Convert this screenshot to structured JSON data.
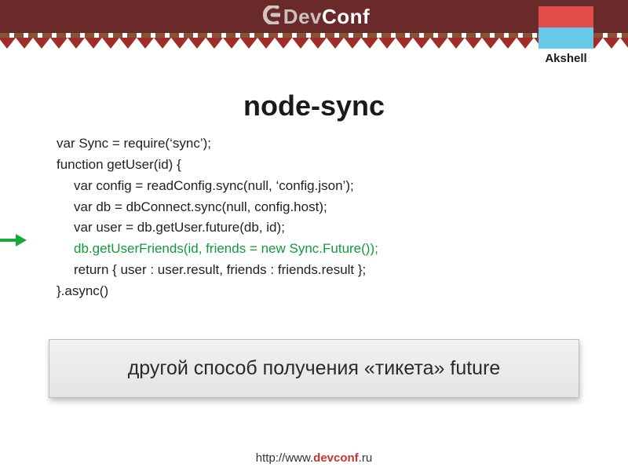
{
  "logo": {
    "text_gray": "Dev",
    "text_white": "Conf"
  },
  "badge": {
    "label": "Akshell"
  },
  "title": "node-sync",
  "code": {
    "l1": "var Sync = require(‘sync’);",
    "l2": "function getUser(id) {",
    "l3": "var config = readConfig.sync(null, ‘config.json’);",
    "l4": "var db = dbConnect.sync(null, config.host);",
    "l5": "var user = db.getUser.future(db, id);",
    "l6": "db.getUserFriends(id, friends = new Sync.Future());",
    "l7": "return { user : user.result, friends : friends.result };",
    "l8": "}.async()"
  },
  "callout": "другой способ получения «тикета» future",
  "footer": {
    "prefix": "http://www.",
    "brand": "devconf",
    "suffix": ".ru"
  }
}
